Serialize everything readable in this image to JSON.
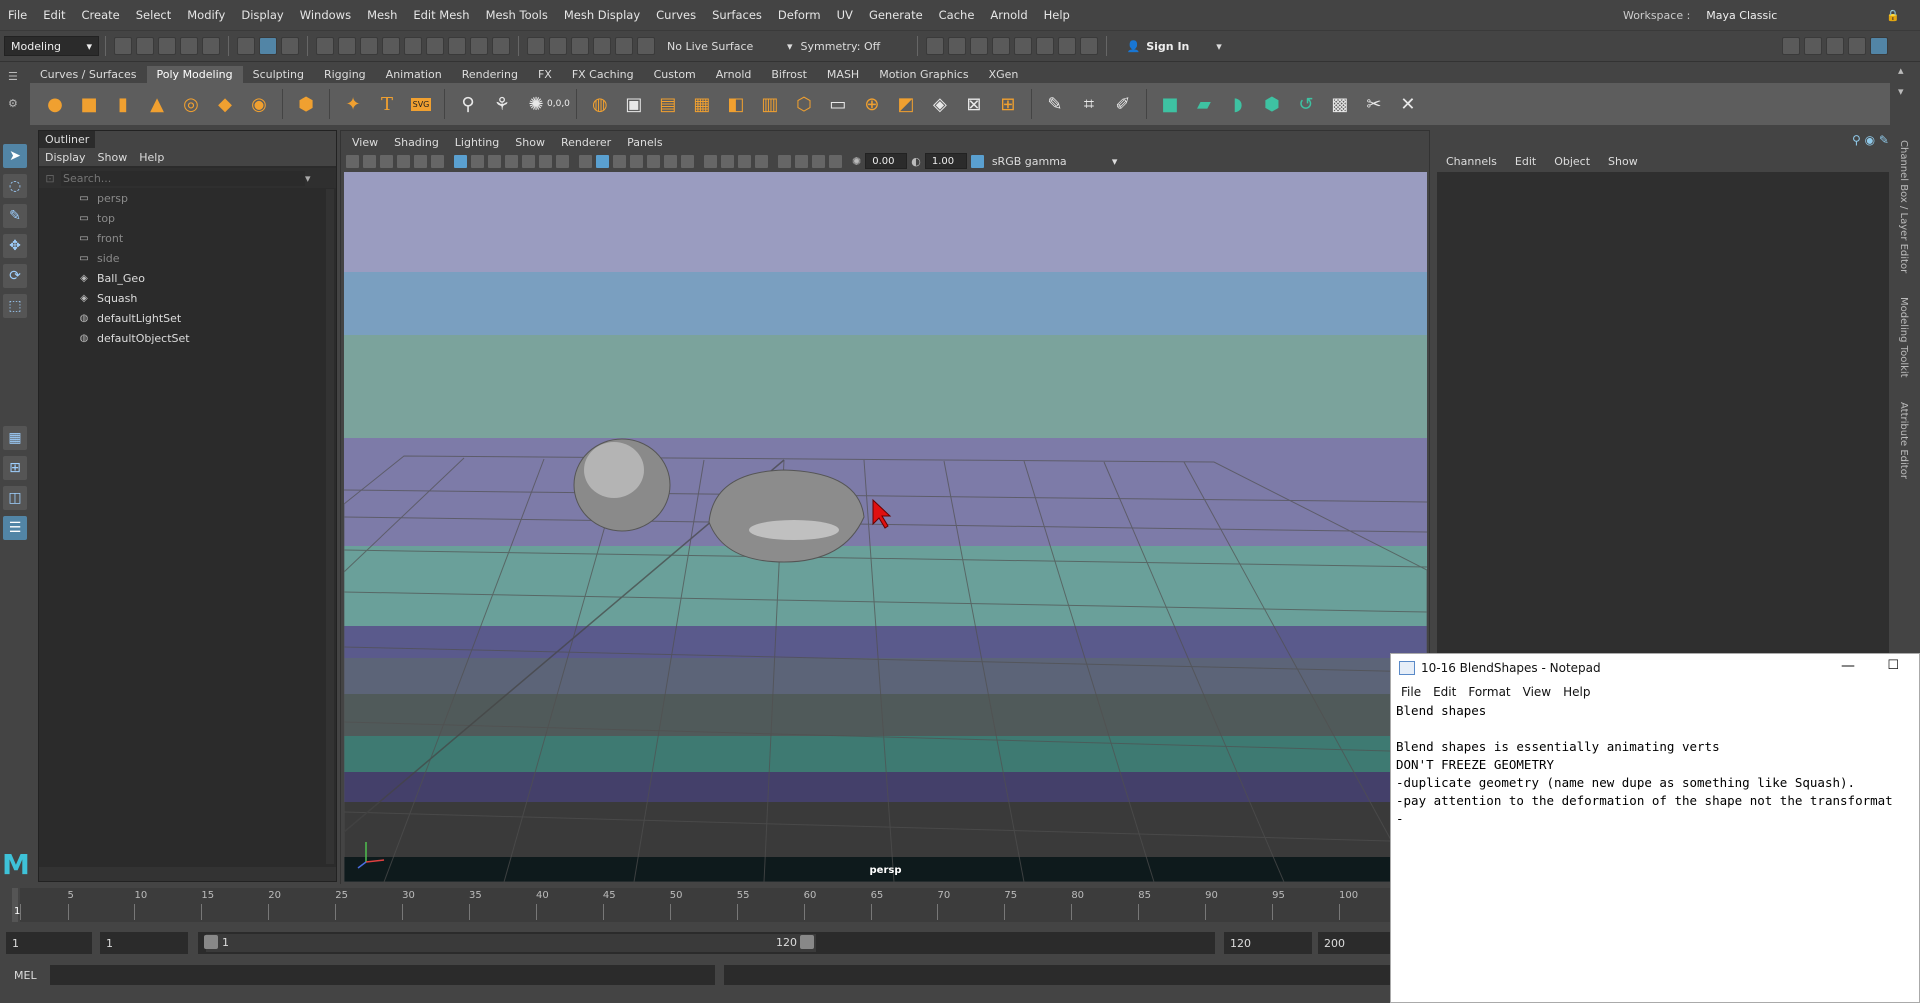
{
  "menubar": {
    "items": [
      "File",
      "Edit",
      "Create",
      "Select",
      "Modify",
      "Display",
      "Windows",
      "Mesh",
      "Edit Mesh",
      "Mesh Tools",
      "Mesh Display",
      "Curves",
      "Surfaces",
      "Deform",
      "UV",
      "Generate",
      "Cache",
      "Arnold",
      "Help"
    ],
    "workspace_label": "Workspace :",
    "workspace_value": "Maya Classic"
  },
  "statusline": {
    "mode": "Modeling",
    "live_surface": "No Live Surface",
    "symmetry": "Symmetry: Off",
    "sign_in": "Sign In"
  },
  "shelf": {
    "tabs": [
      "Curves / Surfaces",
      "Poly Modeling",
      "Sculpting",
      "Rigging",
      "Animation",
      "Rendering",
      "FX",
      "FX Caching",
      "Custom",
      "Arnold",
      "Bifrost",
      "MASH",
      "Motion Graphics",
      "XGen"
    ],
    "active_tab": "Poly Modeling",
    "svg_label": "SVG",
    "coord_label": "0,0,0"
  },
  "outliner": {
    "title": "Outliner",
    "menu": [
      "Display",
      "Show",
      "Help"
    ],
    "search_placeholder": "Search...",
    "items": [
      {
        "label": "persp",
        "icon": "camera-icon",
        "dim": true
      },
      {
        "label": "top",
        "icon": "camera-icon",
        "dim": true
      },
      {
        "label": "front",
        "icon": "camera-icon",
        "dim": true
      },
      {
        "label": "side",
        "icon": "camera-icon",
        "dim": true
      },
      {
        "label": "Ball_Geo",
        "icon": "mesh-icon",
        "dim": false
      },
      {
        "label": "Squash",
        "icon": "mesh-icon",
        "dim": false
      },
      {
        "label": "defaultLightSet",
        "icon": "set-icon",
        "dim": false
      },
      {
        "label": "defaultObjectSet",
        "icon": "set-icon",
        "dim": false
      }
    ]
  },
  "viewport": {
    "menu": [
      "View",
      "Shading",
      "Lighting",
      "Show",
      "Renderer",
      "Panels"
    ],
    "exposure": "0.00",
    "gamma": "1.00",
    "color_space": "sRGB gamma",
    "camera_label": "persp"
  },
  "channelbox": {
    "menu": [
      "Channels",
      "Edit",
      "Object",
      "Show"
    ]
  },
  "side_tabs": [
    "Channel Box / Layer Editor",
    "Modeling Toolkit",
    "Attribute Editor"
  ],
  "timeline": {
    "ticks": [
      "1",
      "5",
      "10",
      "15",
      "20",
      "25",
      "30",
      "35",
      "40",
      "45",
      "50",
      "55",
      "60",
      "65",
      "70",
      "75",
      "80",
      "85",
      "90",
      "95",
      "100"
    ],
    "current_frame": "1"
  },
  "range": {
    "start": "1",
    "playback_start": "1",
    "slider_start": "1",
    "slider_end": "120",
    "playback_end": "120",
    "end": "200"
  },
  "cmdline": {
    "label": "MEL"
  },
  "notepad": {
    "title": "10-16 BlendShapes - Notepad",
    "menu": [
      "File",
      "Edit",
      "Format",
      "View",
      "Help"
    ],
    "lines": [
      "Blend shapes",
      "",
      "Blend shapes is essentially animating verts",
      "DON'T FREEZE GEOMETRY",
      "-duplicate geometry (name new dupe as something like Squash).",
      "-pay attention to the deformation of the shape not the transformat",
      "-"
    ]
  }
}
